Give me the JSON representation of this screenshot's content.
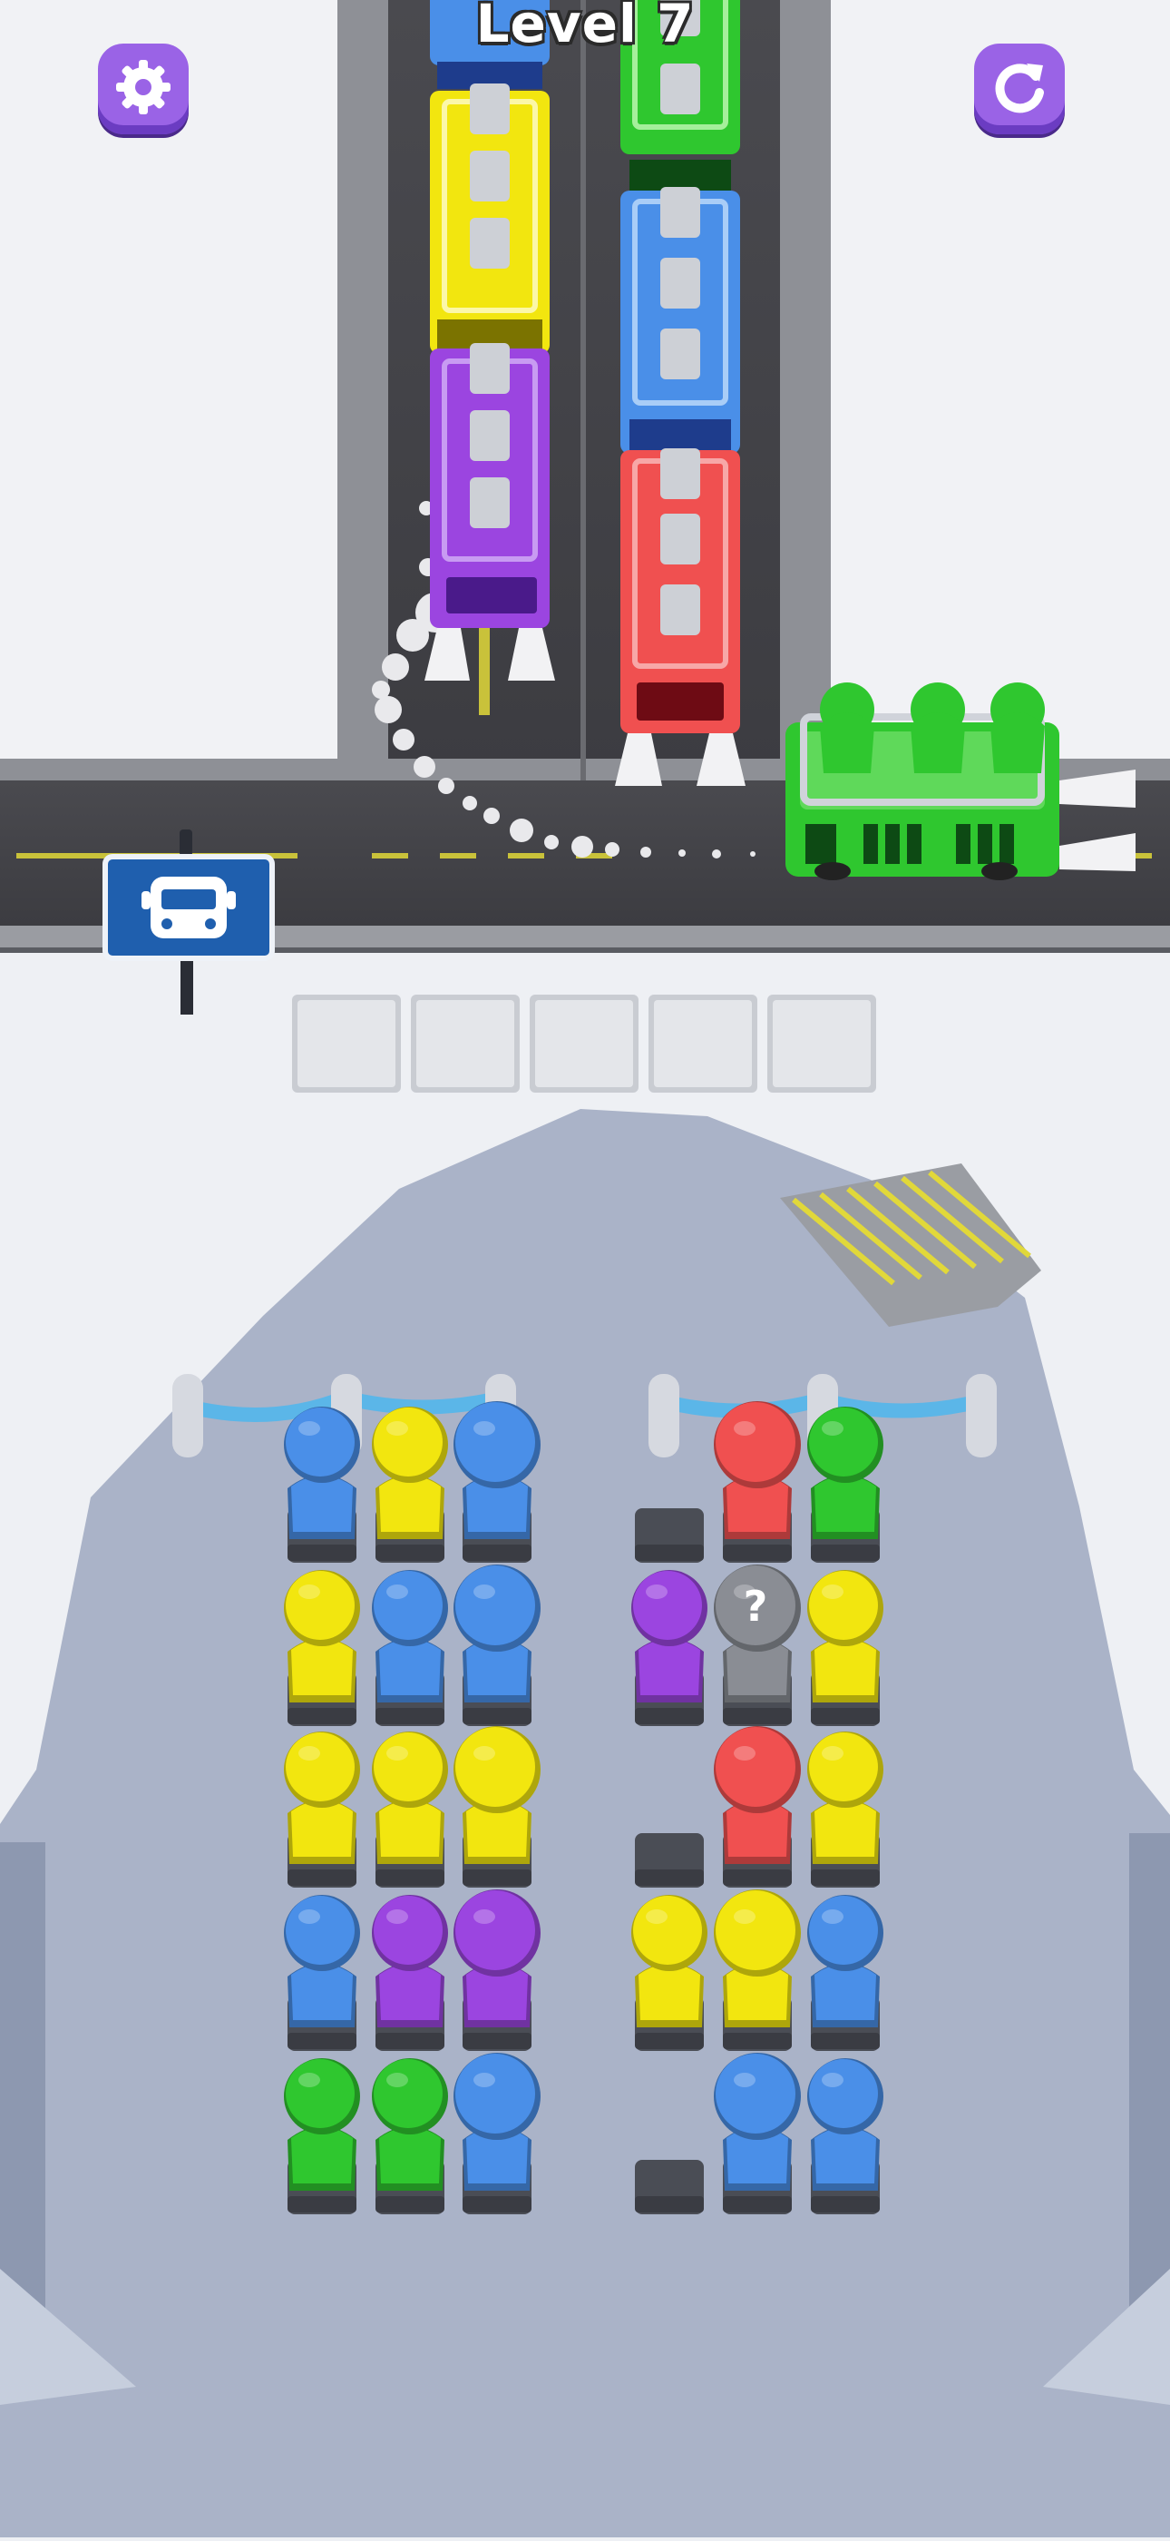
{
  "hud": {
    "level_label": "Level 7",
    "settings_icon": "gear-icon",
    "restart_icon": "restart-icon",
    "accent": "#9a63e6"
  },
  "bus_stop_sign": {
    "icon": "bus-icon",
    "color": "#1f5fae"
  },
  "waiting_slots": {
    "count": 5,
    "filled": 0
  },
  "colors": {
    "blue": "#4a8fe8",
    "yellow": "#f2e60f",
    "green": "#2fc72f",
    "purple": "#9b45e0",
    "red": "#f05050",
    "unknown": "#8a8d94"
  },
  "queue_lanes": [
    {
      "buses": [
        "blue",
        "yellow",
        "purple"
      ]
    },
    {
      "buses": [
        "green",
        "blue",
        "red"
      ]
    }
  ],
  "active_bus": {
    "color": "green",
    "passengers_seated": 3
  },
  "passenger_grid": {
    "left": [
      [
        "blue",
        "yellow",
        "blue"
      ],
      [
        "yellow",
        "blue",
        "blue"
      ],
      [
        "yellow",
        "yellow",
        "yellow"
      ],
      [
        "blue",
        "purple",
        "purple"
      ],
      [
        "green",
        "green",
        "blue"
      ]
    ],
    "right": [
      [
        "empty",
        "red",
        "green"
      ],
      [
        "purple",
        "unknown",
        "yellow"
      ],
      [
        "empty",
        "red",
        "yellow"
      ],
      [
        "yellow",
        "yellow",
        "blue"
      ],
      [
        "empty",
        "blue",
        "blue"
      ]
    ],
    "unknown_symbol": "?"
  }
}
